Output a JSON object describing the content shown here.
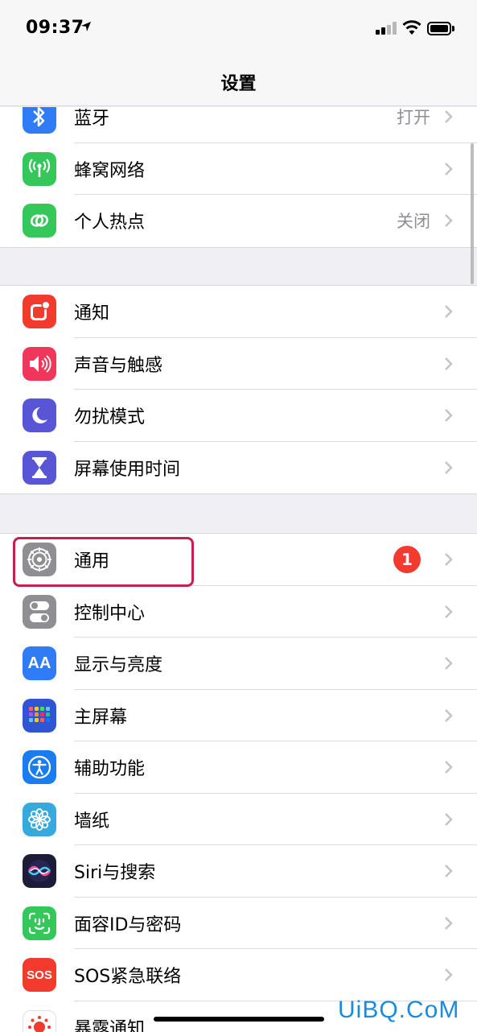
{
  "status_bar": {
    "time": "09:37"
  },
  "nav": {
    "title": "设置"
  },
  "groups": [
    {
      "rows": [
        {
          "label": "蓝牙",
          "value": "打开",
          "icon": "bluetooth-icon",
          "color": "#2f7cf6"
        },
        {
          "label": "蜂窝网络",
          "value": "",
          "icon": "cellular-icon",
          "color": "#34c759"
        },
        {
          "label": "个人热点",
          "value": "关闭",
          "icon": "hotspot-icon",
          "color": "#34c759"
        }
      ]
    },
    {
      "rows": [
        {
          "label": "通知",
          "icon": "notifications-icon",
          "color": "#f23a2f"
        },
        {
          "label": "声音与触感",
          "icon": "sounds-icon",
          "color": "#f0365a"
        },
        {
          "label": "勿扰模式",
          "icon": "do-not-disturb-icon",
          "color": "#5856d6"
        },
        {
          "label": "屏幕使用时间",
          "icon": "screen-time-icon",
          "color": "#5856d6"
        }
      ]
    },
    {
      "rows": [
        {
          "label": "通用",
          "badge": "1",
          "icon": "gear-icon",
          "color": "#8e8e93"
        },
        {
          "label": "控制中心",
          "icon": "control-center-icon",
          "color": "#8e8e93"
        },
        {
          "label": "显示与亮度",
          "icon": "display-icon",
          "color": "#2f7cf6"
        },
        {
          "label": "主屏幕",
          "icon": "home-screen-icon",
          "color": "#2f55d4"
        },
        {
          "label": "辅助功能",
          "icon": "accessibility-icon",
          "color": "#1a7cf0"
        },
        {
          "label": "墙纸",
          "icon": "wallpaper-icon",
          "color": "#36aadc"
        },
        {
          "label": "Siri与搜索",
          "icon": "siri-icon",
          "color": "#1c1c3a"
        },
        {
          "label": "面容ID与密码",
          "icon": "face-id-icon",
          "color": "#34c759"
        },
        {
          "label": "SOS紧急联络",
          "icon": "sos-icon",
          "color": "#f23a2f"
        },
        {
          "label": "暴露通知",
          "icon": "exposure-icon",
          "color": "#ffffff"
        }
      ]
    }
  ],
  "icon_text": {
    "display": "AA",
    "sos": "SOS"
  },
  "watermark": "UiBQ.CoM"
}
